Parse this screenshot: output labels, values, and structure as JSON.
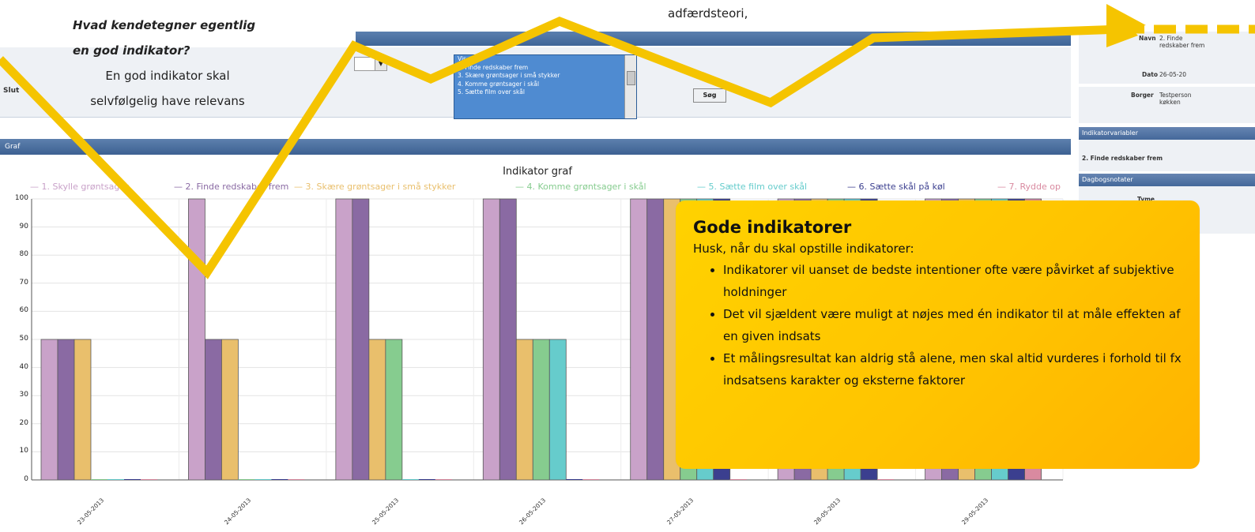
{
  "overlay": {
    "question": "Hvad kendetegner egentlig en god indikator?",
    "bubble_body": "En god indikator skal selvfølgelig have relevans",
    "top_snippet": "adfærdsteori,",
    "callout_title": "Gode indikatorer",
    "callout_lead": "Husk, når du skal opstille indikatorer:",
    "callout_points": [
      "Indikatorer vil uanset de bedste intentioner ofte være påvirket af subjektive holdninger",
      "Det vil sjældent være muligt at nøjes med én indikator til at måle effekten af en given indsats",
      "Et målingsresultat kan aldrig stå alene, men skal altid vurderes i forhold til fx indsatsens karakter og eksterne faktorer"
    ],
    "zigzag_color": "#f5c400"
  },
  "filters": {
    "slut_label": "Slut",
    "soeg_button": "Søg",
    "list_items": [
      "Vis graf",
      "2. Finde redskaber frem",
      "3. Skære grøntsager i små stykker",
      "4. Komme grøntsager i skål",
      "5. Sætte film over skål"
    ]
  },
  "graph_section": {
    "header": "Graf"
  },
  "side_panel": {
    "navn_label": "Navn",
    "navn_value": "2. Finde redskaber frem",
    "dato_label": "Dato",
    "dato_value": "26-05-20",
    "borger_label": "Borger",
    "borger_value": "Testperson køkken",
    "indikator_header": "Indikatorvariabler",
    "indikator_item": "2. Finde redskaber frem",
    "dagbog_header": "Dagbogsnotater",
    "dagbog_col": "Tyme"
  },
  "chart_data": {
    "type": "bar",
    "title": "Indikator graf",
    "xlabel": "",
    "ylabel": "",
    "ylim": [
      0,
      100
    ],
    "yticks": [
      0,
      10,
      20,
      30,
      40,
      50,
      60,
      70,
      80,
      90,
      100
    ],
    "grid": true,
    "legend": "top",
    "categories": [
      "23-05-2013",
      "24-05-2013",
      "25-05-2013",
      "26-05-2013",
      "27-05-2013",
      "28-05-2013",
      "29-05-2013"
    ],
    "series": [
      {
        "name": "1. Skylle grøntsager",
        "color": "#c9a2c9",
        "values": [
          50,
          100,
          100,
          100,
          100,
          100,
          100
        ]
      },
      {
        "name": "2. Finde redskaber frem",
        "color": "#8a6aa3",
        "values": [
          50,
          50,
          100,
          100,
          100,
          100,
          100
        ]
      },
      {
        "name": "3. Skære grøntsager i små stykker",
        "color": "#e9bf6c",
        "values": [
          50,
          50,
          50,
          50,
          100,
          100,
          100
        ]
      },
      {
        "name": "4. Komme grøntsager i skål",
        "color": "#86cc8f",
        "values": [
          0,
          0,
          50,
          50,
          100,
          100,
          100
        ]
      },
      {
        "name": "5. Sætte film over skål",
        "color": "#66cccc",
        "values": [
          0,
          0,
          0,
          50,
          100,
          100,
          100
        ]
      },
      {
        "name": "6. Sætte skål på køl",
        "color": "#3b3f8f",
        "values": [
          0,
          0,
          0,
          0,
          100,
          100,
          100
        ]
      },
      {
        "name": "7. Rydde op",
        "color": "#d98aa0",
        "values": [
          0,
          0,
          0,
          0,
          0,
          0,
          100
        ]
      }
    ]
  }
}
